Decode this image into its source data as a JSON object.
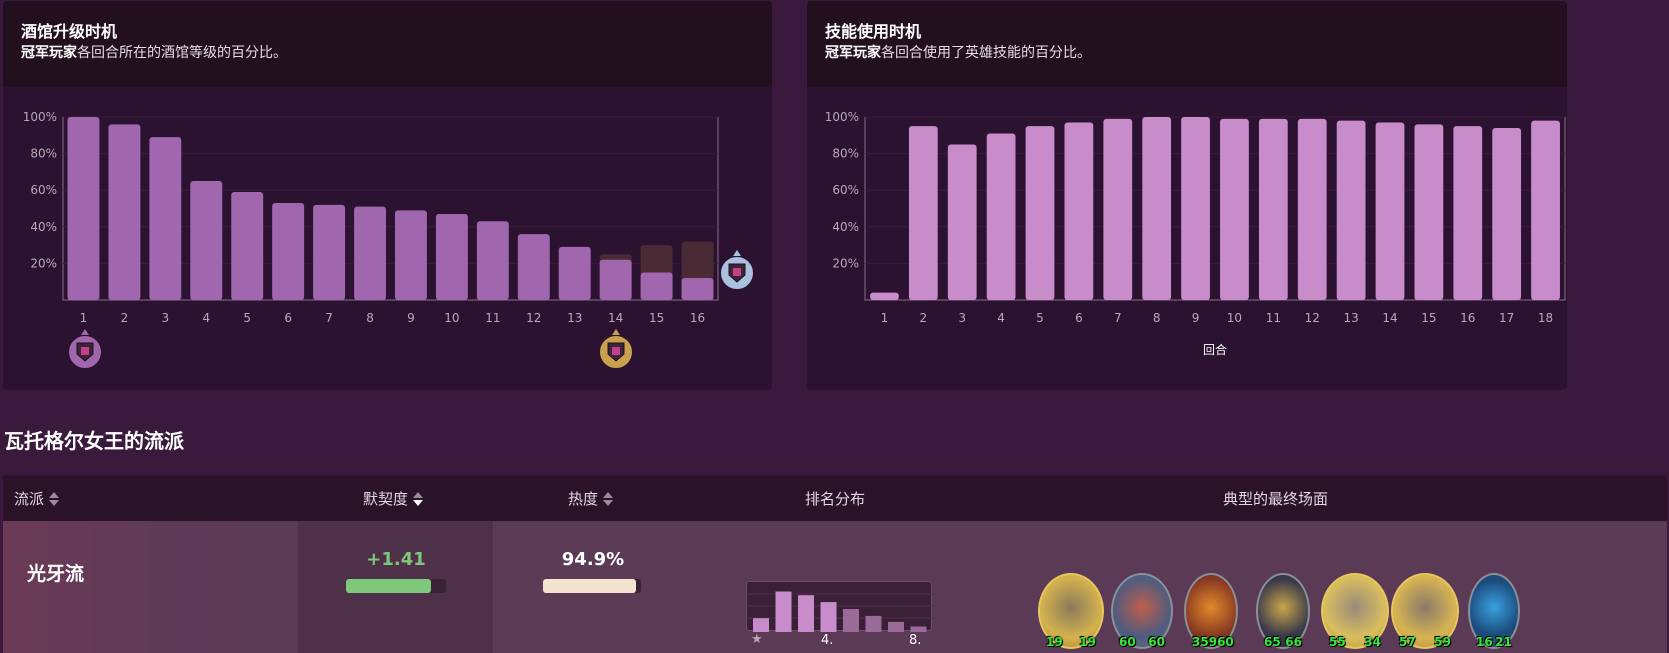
{
  "tavern_panel": {
    "title": "酒馆升级时机",
    "subtitle_bold": "冠军玩家",
    "subtitle_rest": "各回合所在的酒馆等级的百分比。"
  },
  "hero_power_panel": {
    "title": "技能使用时机",
    "subtitle_bold": "冠军玩家",
    "subtitle_rest": "各回合使用了英雄技能的百分比。",
    "xlabel": "回合"
  },
  "section_title": "瓦托格尔女王的流派",
  "table": {
    "headers": {
      "comp": "流派",
      "affinity": "默契度",
      "popularity": "热度",
      "rank_dist": "排名分布",
      "final_board": "典型的最终场面"
    },
    "row": {
      "name": "光牙流",
      "affinity": "+1.41",
      "affinity_fraction": 0.85,
      "popularity": "94.9%",
      "popularity_fraction": 0.949,
      "rank_labels": [
        "4.",
        "8."
      ],
      "rank_bars": [
        0.3,
        0.88,
        0.8,
        0.65,
        0.5,
        0.35,
        0.22,
        0.12
      ],
      "board": [
        {
          "attack": "19",
          "health": "19",
          "icon": "golden-minion"
        },
        {
          "attack": "60",
          "health": "60",
          "icon": "minion"
        },
        {
          "attack": "359",
          "health": "60",
          "icon": "minion"
        },
        {
          "attack": "65",
          "health": "66",
          "icon": "minion"
        },
        {
          "attack": "55",
          "health": "34",
          "icon": "golden-minion"
        },
        {
          "attack": "57",
          "health": "59",
          "icon": "golden-minion"
        },
        {
          "attack": "16",
          "health": "21",
          "icon": "minion"
        }
      ]
    }
  },
  "chart_data": [
    {
      "type": "bar",
      "title": "酒馆升级时机",
      "categories": [
        "1",
        "2",
        "3",
        "4",
        "5",
        "6",
        "7",
        "8",
        "9",
        "10",
        "11",
        "12",
        "13",
        "14",
        "15",
        "16"
      ],
      "ylim": [
        0,
        100
      ],
      "yticks": [
        "20%",
        "40%",
        "60%",
        "80%",
        "100%"
      ],
      "series": [
        {
          "values": [
            100,
            96,
            89,
            65,
            59,
            53,
            52,
            51,
            49,
            47,
            43,
            36,
            29,
            22,
            15,
            12
          ]
        },
        {
          "values": [
            0,
            0,
            0,
            0,
            0,
            0,
            0,
            0,
            0,
            0,
            0,
            0,
            0,
            25,
            30,
            32
          ]
        }
      ],
      "grid": true
    },
    {
      "type": "bar",
      "title": "技能使用时机",
      "xlabel": "回合",
      "categories": [
        "1",
        "2",
        "3",
        "4",
        "5",
        "6",
        "7",
        "8",
        "9",
        "10",
        "11",
        "12",
        "13",
        "14",
        "15",
        "16",
        "17",
        "18"
      ],
      "ylim": [
        0,
        100
      ],
      "yticks": [
        "20%",
        "40%",
        "60%",
        "80%",
        "100%"
      ],
      "series": [
        {
          "values": [
            4,
            95,
            85,
            91,
            95,
            97,
            99,
            100,
            100,
            99,
            99,
            99,
            98,
            97,
            96,
            95,
            94,
            98
          ]
        }
      ],
      "grid": true
    }
  ],
  "colors": {
    "bar_tavern": "#a066ae",
    "bar_tavern_bg": "#4a2a34",
    "bar_hero": "#c98cca",
    "affinity": "#7fc77a",
    "popularity": "#f3e4d2",
    "accent_gold": "#c9a04d"
  }
}
